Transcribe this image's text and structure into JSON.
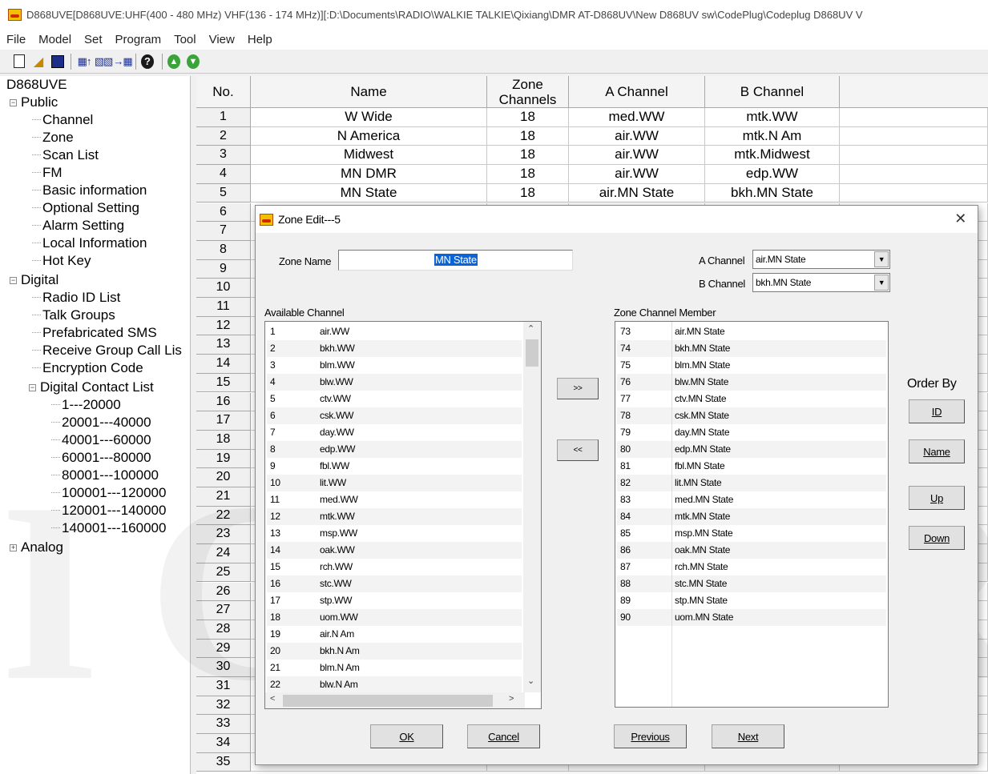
{
  "window": {
    "title": "D868UVE[D868UVE:UHF(400 - 480 MHz) VHF(136 - 174 MHz)][:D:\\Documents\\RADIO\\WALKIE TALKIE\\Qixiang\\DMR AT-D868UV\\New D868UV sw\\CodePlug\\Codeplug D868UV V"
  },
  "menu": [
    "File",
    "Model",
    "Set",
    "Program",
    "Tool",
    "View",
    "Help"
  ],
  "tree": {
    "root": "D868UVE",
    "public": {
      "label": "Public",
      "items": [
        "Channel",
        "Zone",
        "Scan List",
        "FM",
        "Basic information",
        "Optional Setting",
        "Alarm Setting",
        "Local Information",
        "Hot Key"
      ]
    },
    "digital": {
      "label": "Digital",
      "items": [
        "Radio ID List",
        "Talk Groups",
        "Prefabricated SMS",
        "Receive Group Call Lis",
        "Encryption Code"
      ]
    },
    "contact": {
      "label": "Digital Contact List",
      "items": [
        "1---20000",
        "20001---40000",
        "40001---60000",
        "60001---80000",
        "80001---100000",
        "100001---120000",
        "120001---140000",
        "140001---160000"
      ]
    },
    "analog": "Analog"
  },
  "grid": {
    "headers": {
      "no": "No.",
      "name": "Name",
      "zone_channels": "Zone Channels",
      "a_channel": "A Channel",
      "b_channel": "B Channel"
    },
    "rows": [
      {
        "no": "1",
        "name": "W Wide",
        "count": "18",
        "a": "med.WW",
        "b": "mtk.WW"
      },
      {
        "no": "2",
        "name": "N America",
        "count": "18",
        "a": "air.WW",
        "b": "mtk.N Am"
      },
      {
        "no": "3",
        "name": "Midwest",
        "count": "18",
        "a": "air.WW",
        "b": "mtk.Midwest"
      },
      {
        "no": "4",
        "name": "MN DMR",
        "count": "18",
        "a": "air.WW",
        "b": "edp.WW"
      },
      {
        "no": "5",
        "name": "MN State",
        "count": "18",
        "a": "air.MN State",
        "b": "bkh.MN State"
      }
    ],
    "row_numbers": [
      "6",
      "7",
      "8",
      "9",
      "10",
      "11",
      "12",
      "13",
      "14",
      "15",
      "16",
      "17",
      "18",
      "19",
      "20",
      "21",
      "22",
      "23",
      "24",
      "25",
      "26",
      "27",
      "28",
      "29",
      "30",
      "31",
      "32",
      "33",
      "34",
      "35"
    ]
  },
  "watermark": "ICVERS",
  "dialog": {
    "title": "Zone Edit---5",
    "zone_name_label": "Zone Name",
    "zone_name_value": "MN State",
    "a_channel_label": "A Channel",
    "a_channel_value": "air.MN State",
    "b_channel_label": "B Channel",
    "b_channel_value": "bkh.MN State",
    "available_label": "Available Channel",
    "member_label": "Zone Channel Member",
    "available": [
      {
        "n": "1",
        "c": "air.WW"
      },
      {
        "n": "2",
        "c": "bkh.WW"
      },
      {
        "n": "3",
        "c": "blm.WW"
      },
      {
        "n": "4",
        "c": "blw.WW"
      },
      {
        "n": "5",
        "c": "ctv.WW"
      },
      {
        "n": "6",
        "c": "csk.WW"
      },
      {
        "n": "7",
        "c": "day.WW"
      },
      {
        "n": "8",
        "c": "edp.WW"
      },
      {
        "n": "9",
        "c": "fbl.WW"
      },
      {
        "n": "10",
        "c": "lit.WW"
      },
      {
        "n": "11",
        "c": "med.WW"
      },
      {
        "n": "12",
        "c": "mtk.WW"
      },
      {
        "n": "13",
        "c": "msp.WW"
      },
      {
        "n": "14",
        "c": "oak.WW"
      },
      {
        "n": "15",
        "c": "rch.WW"
      },
      {
        "n": "16",
        "c": "stc.WW"
      },
      {
        "n": "17",
        "c": "stp.WW"
      },
      {
        "n": "18",
        "c": "uom.WW"
      },
      {
        "n": "19",
        "c": "air.N Am"
      },
      {
        "n": "20",
        "c": "bkh.N Am"
      },
      {
        "n": "21",
        "c": "blm.N Am"
      },
      {
        "n": "22",
        "c": "blw.N Am"
      }
    ],
    "members": [
      {
        "n": "73",
        "c": "air.MN State"
      },
      {
        "n": "74",
        "c": "bkh.MN State"
      },
      {
        "n": "75",
        "c": "blm.MN State"
      },
      {
        "n": "76",
        "c": "blw.MN State"
      },
      {
        "n": "77",
        "c": "ctv.MN State"
      },
      {
        "n": "78",
        "c": "csk.MN State"
      },
      {
        "n": "79",
        "c": "day.MN State"
      },
      {
        "n": "80",
        "c": "edp.MN State"
      },
      {
        "n": "81",
        "c": "fbl.MN State"
      },
      {
        "n": "82",
        "c": "lit.MN State"
      },
      {
        "n": "83",
        "c": "med.MN State"
      },
      {
        "n": "84",
        "c": "mtk.MN State"
      },
      {
        "n": "85",
        "c": "msp.MN State"
      },
      {
        "n": "86",
        "c": "oak.MN State"
      },
      {
        "n": "87",
        "c": "rch.MN State"
      },
      {
        "n": "88",
        "c": "stc.MN State"
      },
      {
        "n": "89",
        "c": "stp.MN State"
      },
      {
        "n": "90",
        "c": "uom.MN State"
      }
    ],
    "add_label": ">>",
    "remove_label": "<<",
    "order_by_label": "Order By",
    "order_buttons": {
      "id": "ID",
      "name": "Name",
      "up": "Up",
      "down": "Down"
    },
    "buttons": {
      "ok": "OK",
      "cancel": "Cancel",
      "previous": "Previous",
      "next": "Next"
    }
  }
}
